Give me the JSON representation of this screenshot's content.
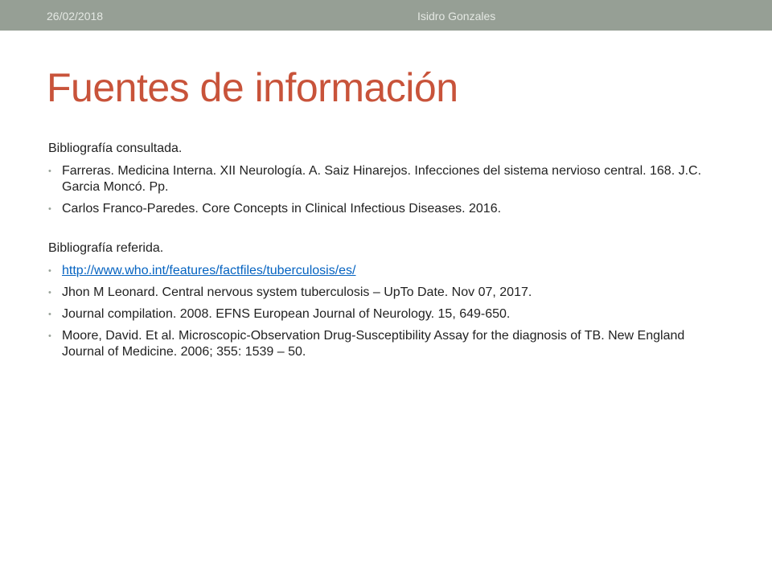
{
  "header": {
    "date": "26/02/2018",
    "author": "Isidro Gonzales"
  },
  "title": "Fuentes de información",
  "sections": {
    "consulted": {
      "heading": "Bibliografía consultada.",
      "items": [
        "Farreras. Medicina Interna. XII Neurología. A. Saiz Hinarejos. Infecciones del sistema nervioso central. 168. J.C. Garcia Moncó. Pp.",
        "Carlos Franco-Paredes. Core Concepts in Clinical Infectious Diseases. 2016."
      ]
    },
    "referred": {
      "heading": "Bibliografía referida.",
      "link": "http://www.who.int/features/factfiles/tuberculosis/es/",
      "items": [
        "Jhon M Leonard. Central nervous system tuberculosis – UpTo Date. Nov 07, 2017.",
        "Journal compilation. 2008. EFNS European Journal of Neurology. 15, 649-650.",
        "Moore, David. Et al. Microscopic-Observation Drug-Susceptibility Assay for the diagnosis of TB. New England Journal of Medicine. 2006; 355: 1539 – 50."
      ]
    }
  },
  "colors": {
    "top_bar": "#969f95",
    "title": "#c8533a",
    "link": "#0563c1"
  }
}
